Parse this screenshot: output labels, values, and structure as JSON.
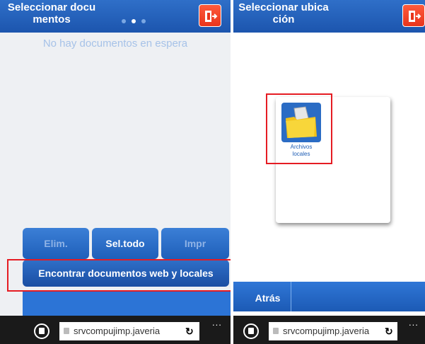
{
  "left_screen": {
    "header": {
      "title_line1": "Seleccionar docu",
      "title_line2": "mentos"
    },
    "empty_message": "No hay documentos en espera",
    "buttons": {
      "delete": "Elim.",
      "select_all": "Sel.todo",
      "print": "Impr"
    },
    "find_button": "Encontrar documentos web y locales",
    "browser": {
      "url": "srvcompujimp.javeria",
      "more": "..."
    }
  },
  "right_screen": {
    "header": {
      "title_line1": "Seleccionar ubica",
      "title_line2": "ción"
    },
    "location_tile": {
      "label_line1": "Archivos",
      "label_line2": "locales"
    },
    "back_button": "Atrás",
    "browser": {
      "url": "srvcompujimp.javeria",
      "more": "..."
    }
  },
  "colors": {
    "header_blue": "#1c55ae",
    "button_blue": "#2f6fc8",
    "exit_orange": "#e8351c",
    "highlight_red": "#e51c23"
  },
  "icons": [
    "exit-icon",
    "folder-icon",
    "tabs-icon",
    "lock-icon",
    "refresh-icon",
    "more-icon"
  ]
}
